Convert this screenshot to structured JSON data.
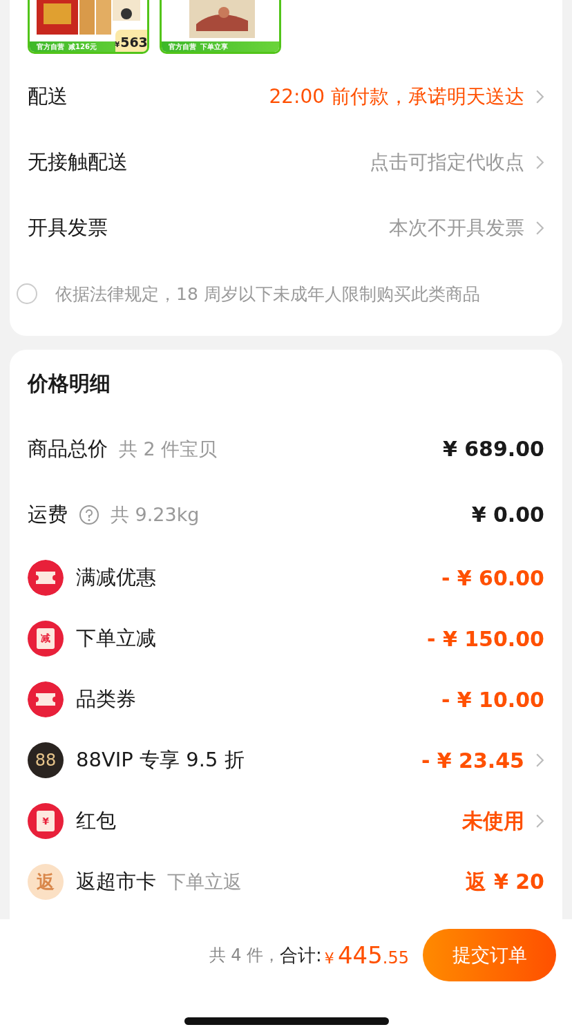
{
  "products": [
    {
      "tag": "官方自营",
      "promo": "减126元",
      "price_currency": "¥",
      "price": "563"
    },
    {
      "tag": "官方自营",
      "promo": "下单立享"
    }
  ],
  "options": [
    {
      "kind": "promise",
      "label": "配送",
      "value": "22:00 前付款，承诺明天送达"
    },
    {
      "kind": "plain",
      "label": "无接触配送",
      "value": "点击可指定代收点"
    },
    {
      "kind": "plain",
      "label": "开具发票",
      "value": "本次不开具发票"
    }
  ],
  "agreement": {
    "checked": false,
    "text": "依据法律规定，18 周岁以下未成年人限制购买此类商品"
  },
  "price_detail": {
    "title": "价格明细",
    "rows": [
      {
        "kind": "summary",
        "label": "商品总价",
        "note": "共 2 件宝贝",
        "amount": "¥ 689.00",
        "help": false
      },
      {
        "kind": "summary",
        "label": "运费",
        "note": "共 9.23kg",
        "amount": "¥ 0.00",
        "help": true
      },
      {
        "kind": "coupon",
        "label": "满减优惠",
        "amount": "- ¥ 60.00",
        "chevron": false
      },
      {
        "kind": "instant",
        "badge": "减",
        "label": "下单立减",
        "amount": "- ¥ 150.00",
        "chevron": false
      },
      {
        "kind": "coupon",
        "label": "品类券",
        "amount": "- ¥ 10.00",
        "chevron": false
      },
      {
        "kind": "vip",
        "badge": "88",
        "label": "88VIP 专享 9.5 折",
        "amount": "- ¥ 23.45",
        "chevron": true
      },
      {
        "kind": "redpacket",
        "badge": "¥",
        "label": "红包",
        "amount": "未使用",
        "chevron": true
      },
      {
        "kind": "cashback",
        "badge": "返",
        "label": "返超市卡",
        "note": "下单立返",
        "amount": "返 ¥ 20",
        "chevron": false
      }
    ]
  },
  "footer": {
    "count": "共 4 件，",
    "total_label": "合计:",
    "currency": "¥",
    "total_int": "445",
    "total_dec": ".55",
    "submit": "提交订单"
  }
}
